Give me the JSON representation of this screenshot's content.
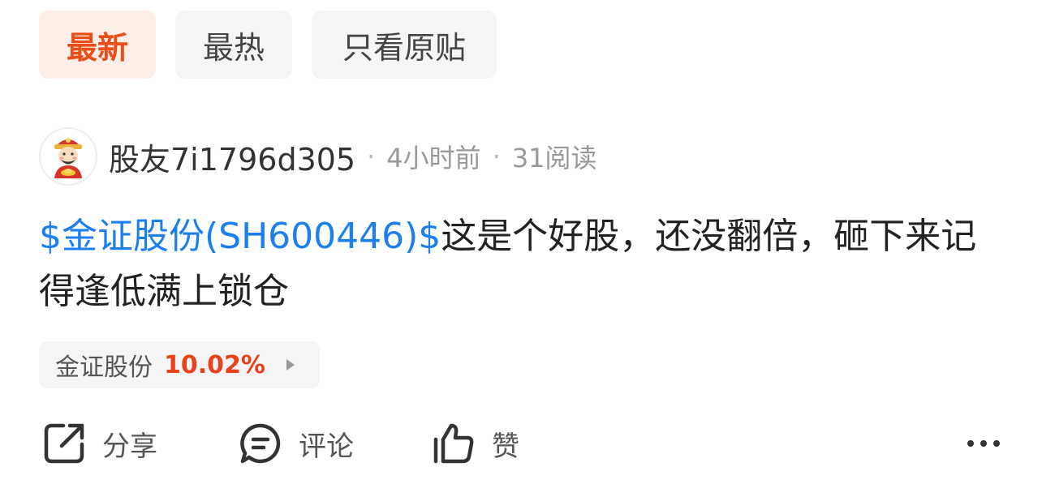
{
  "tabs": [
    {
      "label": "最新",
      "active": true
    },
    {
      "label": "最热",
      "active": false
    },
    {
      "label": "只看原贴",
      "active": false
    }
  ],
  "post": {
    "username": "股友7i1796d305",
    "time": "4小时前",
    "reads": "31阅读",
    "stock_link": "$金证股份(SH600446)$",
    "text": "这是个好股，还没翻倍，砸下来记得逢低满上锁仓"
  },
  "stock_chip": {
    "name": "金证股份",
    "change": "10.02%"
  },
  "actions": {
    "share": "分享",
    "comment": "评论",
    "like": "赞"
  },
  "colors": {
    "accent": "#ea4d17",
    "link": "#1c7ff0",
    "up": "#e8421a"
  },
  "icons": [
    "avatar-caishen",
    "share-icon",
    "comment-icon",
    "like-icon",
    "more-icon",
    "play-arrow-icon"
  ]
}
